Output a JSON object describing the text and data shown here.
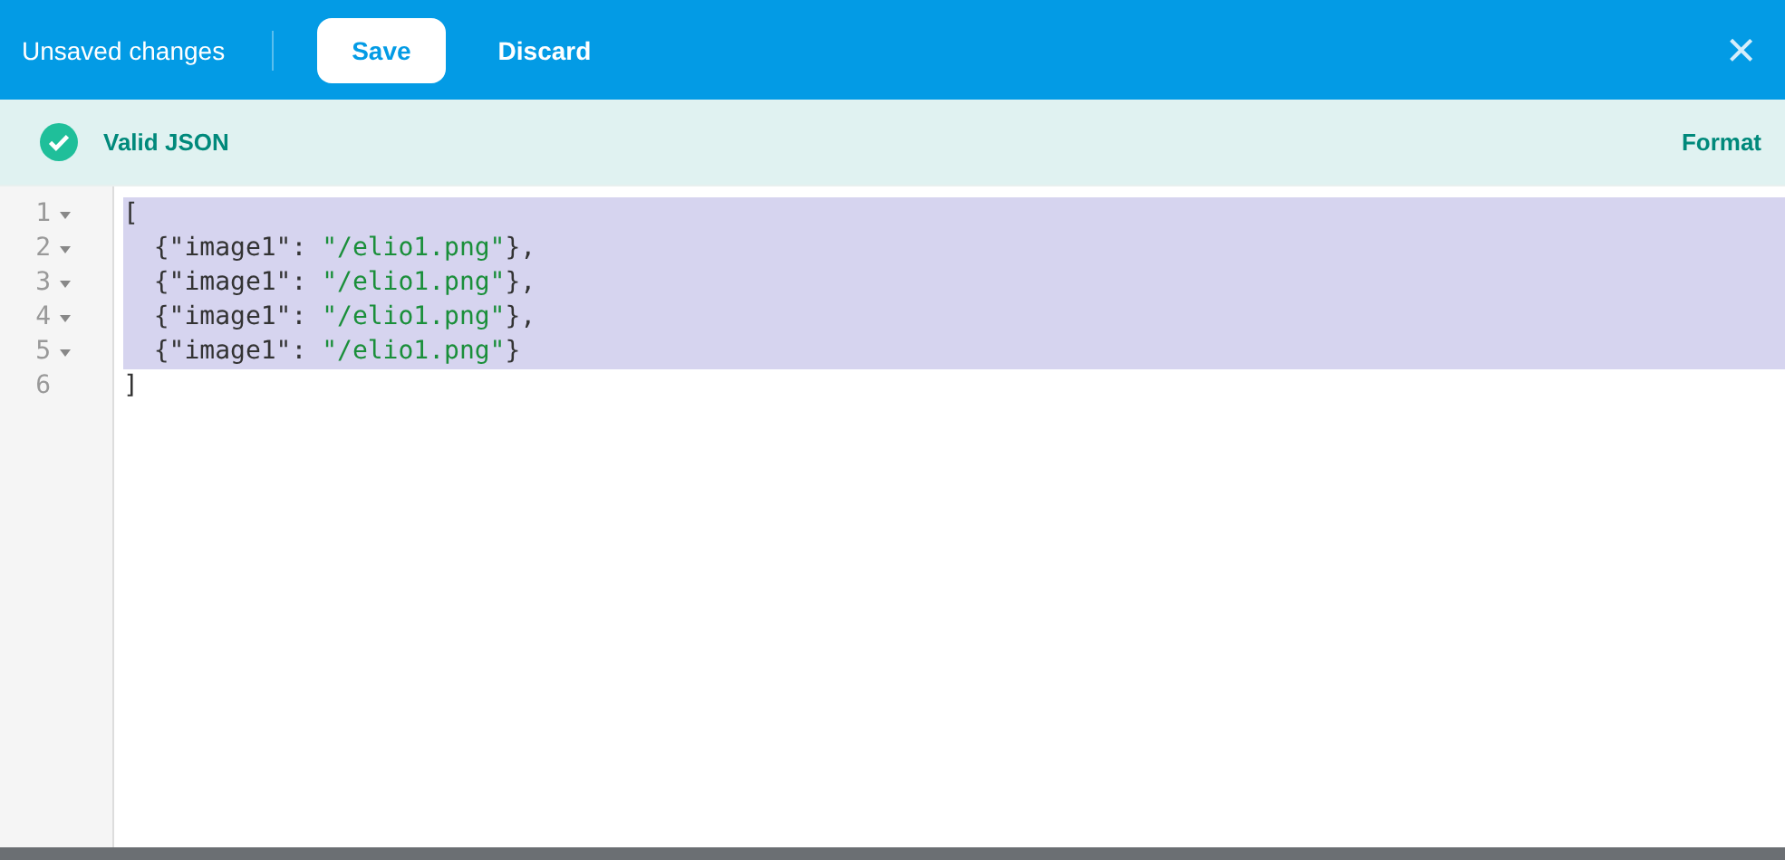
{
  "header": {
    "title": "Unsaved changes",
    "buttons": [
      {
        "label": "Save",
        "kind": "primary"
      },
      {
        "label": "Discard",
        "kind": "text"
      }
    ],
    "close": "×"
  },
  "status": {
    "message": "Valid JSON",
    "valid": true,
    "action": "Format"
  },
  "editor": {
    "lines": [
      {
        "number": "1",
        "foldable": true,
        "selected": true,
        "tokens": [
          {
            "kind": "punct",
            "text": "["
          }
        ]
      },
      {
        "number": "2",
        "foldable": true,
        "selected": true,
        "tokens": [
          {
            "kind": "punct",
            "text": "  {"
          },
          {
            "kind": "key",
            "text": "\"image1\""
          },
          {
            "kind": "punct",
            "text": ": "
          },
          {
            "kind": "string",
            "text": "\"/elio1.png\""
          },
          {
            "kind": "punct",
            "text": "},"
          }
        ]
      },
      {
        "number": "3",
        "foldable": true,
        "selected": true,
        "tokens": [
          {
            "kind": "punct",
            "text": "  {"
          },
          {
            "kind": "key",
            "text": "\"image1\""
          },
          {
            "kind": "punct",
            "text": ": "
          },
          {
            "kind": "string",
            "text": "\"/elio1.png\""
          },
          {
            "kind": "punct",
            "text": "},"
          }
        ]
      },
      {
        "number": "4",
        "foldable": true,
        "selected": true,
        "tokens": [
          {
            "kind": "punct",
            "text": "  {"
          },
          {
            "kind": "key",
            "text": "\"image1\""
          },
          {
            "kind": "punct",
            "text": ": "
          },
          {
            "kind": "string",
            "text": "\"/elio1.png\""
          },
          {
            "kind": "punct",
            "text": "},"
          }
        ]
      },
      {
        "number": "5",
        "foldable": true,
        "selected": true,
        "tokens": [
          {
            "kind": "punct",
            "text": "  {"
          },
          {
            "kind": "key",
            "text": "\"image1\""
          },
          {
            "kind": "punct",
            "text": ": "
          },
          {
            "kind": "string",
            "text": "\"/elio1.png\""
          },
          {
            "kind": "punct",
            "text": "}"
          }
        ]
      },
      {
        "number": "6",
        "foldable": false,
        "selected": false,
        "tokens": [
          {
            "kind": "punct",
            "text": "]"
          }
        ]
      }
    ]
  }
}
